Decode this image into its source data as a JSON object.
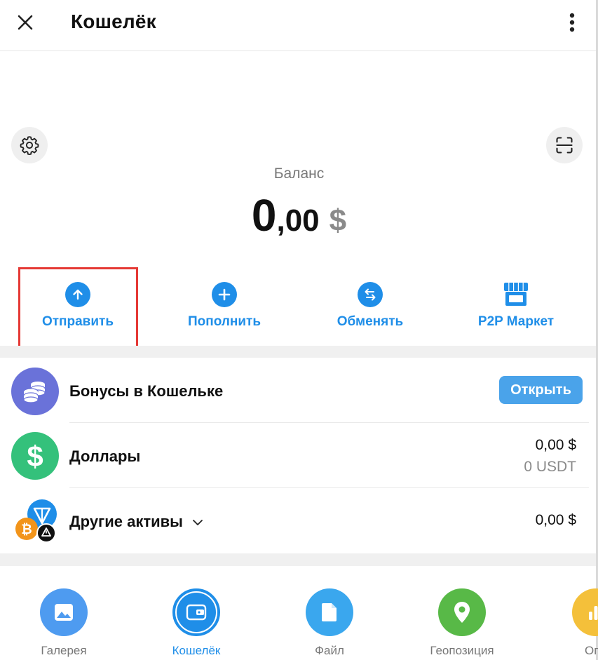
{
  "header": {
    "title": "Кошелёк",
    "close_icon": "close-icon",
    "more_icon": "more-vertical-icon"
  },
  "balance": {
    "label": "Баланс",
    "integer": "0",
    "fraction": ",00",
    "currency": "$"
  },
  "actions": [
    {
      "label": "Отправить",
      "icon": "arrow-up-icon"
    },
    {
      "label": "Пополнить",
      "icon": "plus-icon"
    },
    {
      "label": "Обменять",
      "icon": "swap-icon"
    },
    {
      "label": "P2P Маркет",
      "icon": "store-icon"
    }
  ],
  "assets": {
    "bonus": {
      "title": "Бонусы в Кошельке",
      "button": "Открыть"
    },
    "dollars": {
      "title": "Доллары",
      "amount": "0,00 $",
      "sub_amount": "0 USDT"
    },
    "other": {
      "title": "Другие активы",
      "amount": "0,00 $"
    }
  },
  "bottom_tabs": [
    {
      "label": "Галерея",
      "active": false
    },
    {
      "label": "Кошелёк",
      "active": true
    },
    {
      "label": "Файл",
      "active": false
    },
    {
      "label": "Геопозиция",
      "active": false
    },
    {
      "label": "Опр",
      "active": false
    }
  ],
  "colors": {
    "accent": "#1f8ee8",
    "highlight_box": "#e53935",
    "bonus_icon_bg": "#6a72d9",
    "dollar_icon_bg": "#34c17b",
    "gallery_tab": "#4e9bf0",
    "file_tab": "#3aa7ee",
    "geo_tab": "#58b947",
    "poll_tab": "#f4c03a"
  }
}
